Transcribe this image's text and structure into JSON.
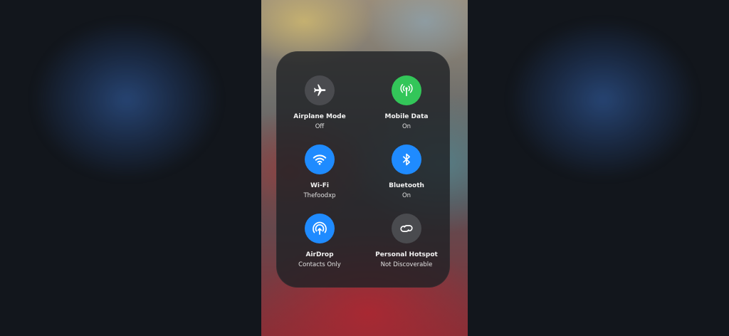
{
  "control_center": {
    "tiles": [
      {
        "label": "Airplane Mode",
        "status": "Off",
        "icon": "airplane-icon",
        "color": "#4a4b4f"
      },
      {
        "label": "Mobile Data",
        "status": "On",
        "icon": "antenna-icon",
        "color": "#33c659"
      },
      {
        "label": "Wi-Fi",
        "status": "Thefoodxp",
        "icon": "wifi-icon",
        "color": "#1f8bff"
      },
      {
        "label": "Bluetooth",
        "status": "On",
        "icon": "bluetooth-icon",
        "color": "#1f8bff"
      },
      {
        "label": "AirDrop",
        "status": "Contacts Only",
        "icon": "airdrop-icon",
        "color": "#1f8bff"
      },
      {
        "label": "Personal Hotspot",
        "status": "Not Discoverable",
        "icon": "hotspot-link-icon",
        "color": "#4a4b4f"
      }
    ]
  }
}
